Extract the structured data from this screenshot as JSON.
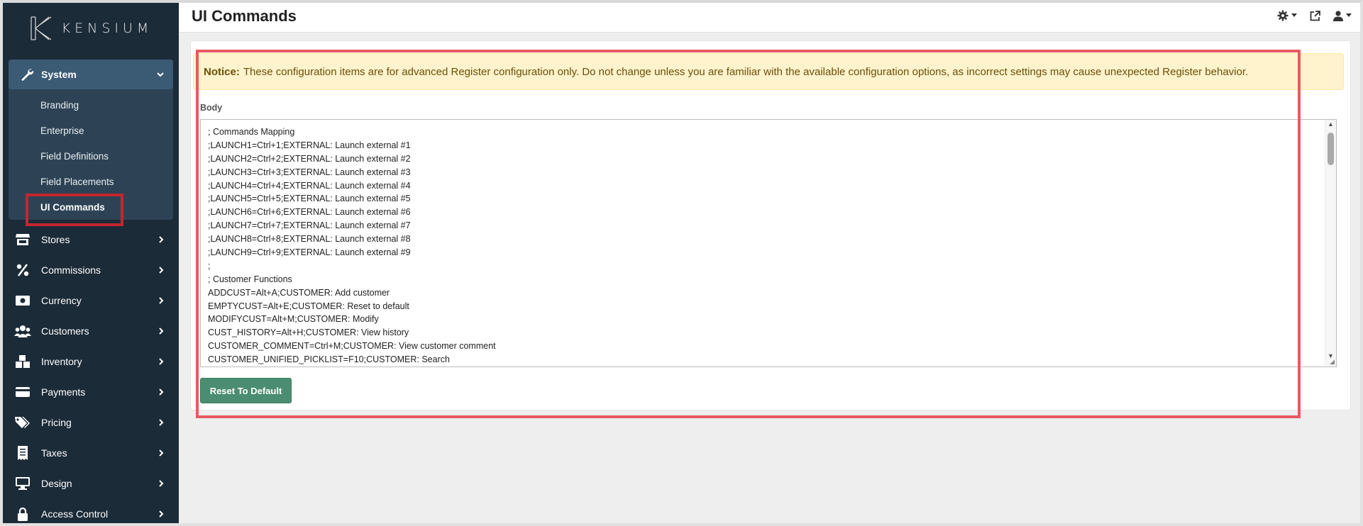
{
  "brand": {
    "logo_text": "KENSIUM"
  },
  "page": {
    "title": "UI Commands"
  },
  "sidebar": {
    "open_group": {
      "label": "System",
      "items": [
        {
          "label": "Branding"
        },
        {
          "label": "Enterprise"
        },
        {
          "label": "Field Definitions"
        },
        {
          "label": "Field Placements"
        },
        {
          "label": "UI Commands",
          "active": true
        }
      ]
    },
    "items": [
      {
        "label": "Stores",
        "icon": "store-icon"
      },
      {
        "label": "Commissions",
        "icon": "percent-icon"
      },
      {
        "label": "Currency",
        "icon": "money-icon"
      },
      {
        "label": "Customers",
        "icon": "users-icon"
      },
      {
        "label": "Inventory",
        "icon": "boxes-icon"
      },
      {
        "label": "Payments",
        "icon": "credit-card-icon"
      },
      {
        "label": "Pricing",
        "icon": "tags-icon"
      },
      {
        "label": "Taxes",
        "icon": "receipt-icon"
      },
      {
        "label": "Design",
        "icon": "monitor-icon"
      },
      {
        "label": "Access Control",
        "icon": "lock-icon"
      }
    ]
  },
  "topbar": {
    "icons": [
      "settings-gear-icon",
      "external-link-icon",
      "user-icon"
    ]
  },
  "notice": {
    "title": "Notice:",
    "text": "These configuration items are for advanced Register configuration only. Do not change unless you are familiar with the available configuration options, as incorrect settings may cause unexpected Register behavior."
  },
  "editor": {
    "label": "Body",
    "lines": [
      "; Commands Mapping",
      ";LAUNCH1=Ctrl+1;EXTERNAL: Launch external #1",
      ";LAUNCH2=Ctrl+2;EXTERNAL: Launch external #2",
      ";LAUNCH3=Ctrl+3;EXTERNAL: Launch external #3",
      ";LAUNCH4=Ctrl+4;EXTERNAL: Launch external #4",
      ";LAUNCH5=Ctrl+5;EXTERNAL: Launch external #5",
      ";LAUNCH6=Ctrl+6;EXTERNAL: Launch external #6",
      ";LAUNCH7=Ctrl+7;EXTERNAL: Launch external #7",
      ";LAUNCH8=Ctrl+8;EXTERNAL: Launch external #8",
      ";LAUNCH9=Ctrl+9;EXTERNAL: Launch external #9",
      ";",
      "; Customer Functions",
      "ADDCUST=Alt+A;CUSTOMER: Add customer",
      "EMPTYCUST=Alt+E;CUSTOMER: Reset to default",
      "MODIFYCUST=Alt+M;CUSTOMER: Modify",
      "CUST_HISTORY=Alt+H;CUSTOMER: View history",
      "CUSTOMER_COMMENT=Ctrl+M;CUSTOMER: View customer comment",
      "CUSTOMER_UNIFIED_PICKLIST=F10;CUSTOMER: Search"
    ]
  },
  "actions": {
    "reset_label": "Reset To Default"
  },
  "colors": {
    "sidebar_bg": "#1c2b38",
    "active_group_bg": "#3b5a74",
    "highlight": "#e85a62",
    "button": "#4a8d72",
    "notice_bg": "#fff3cd"
  }
}
